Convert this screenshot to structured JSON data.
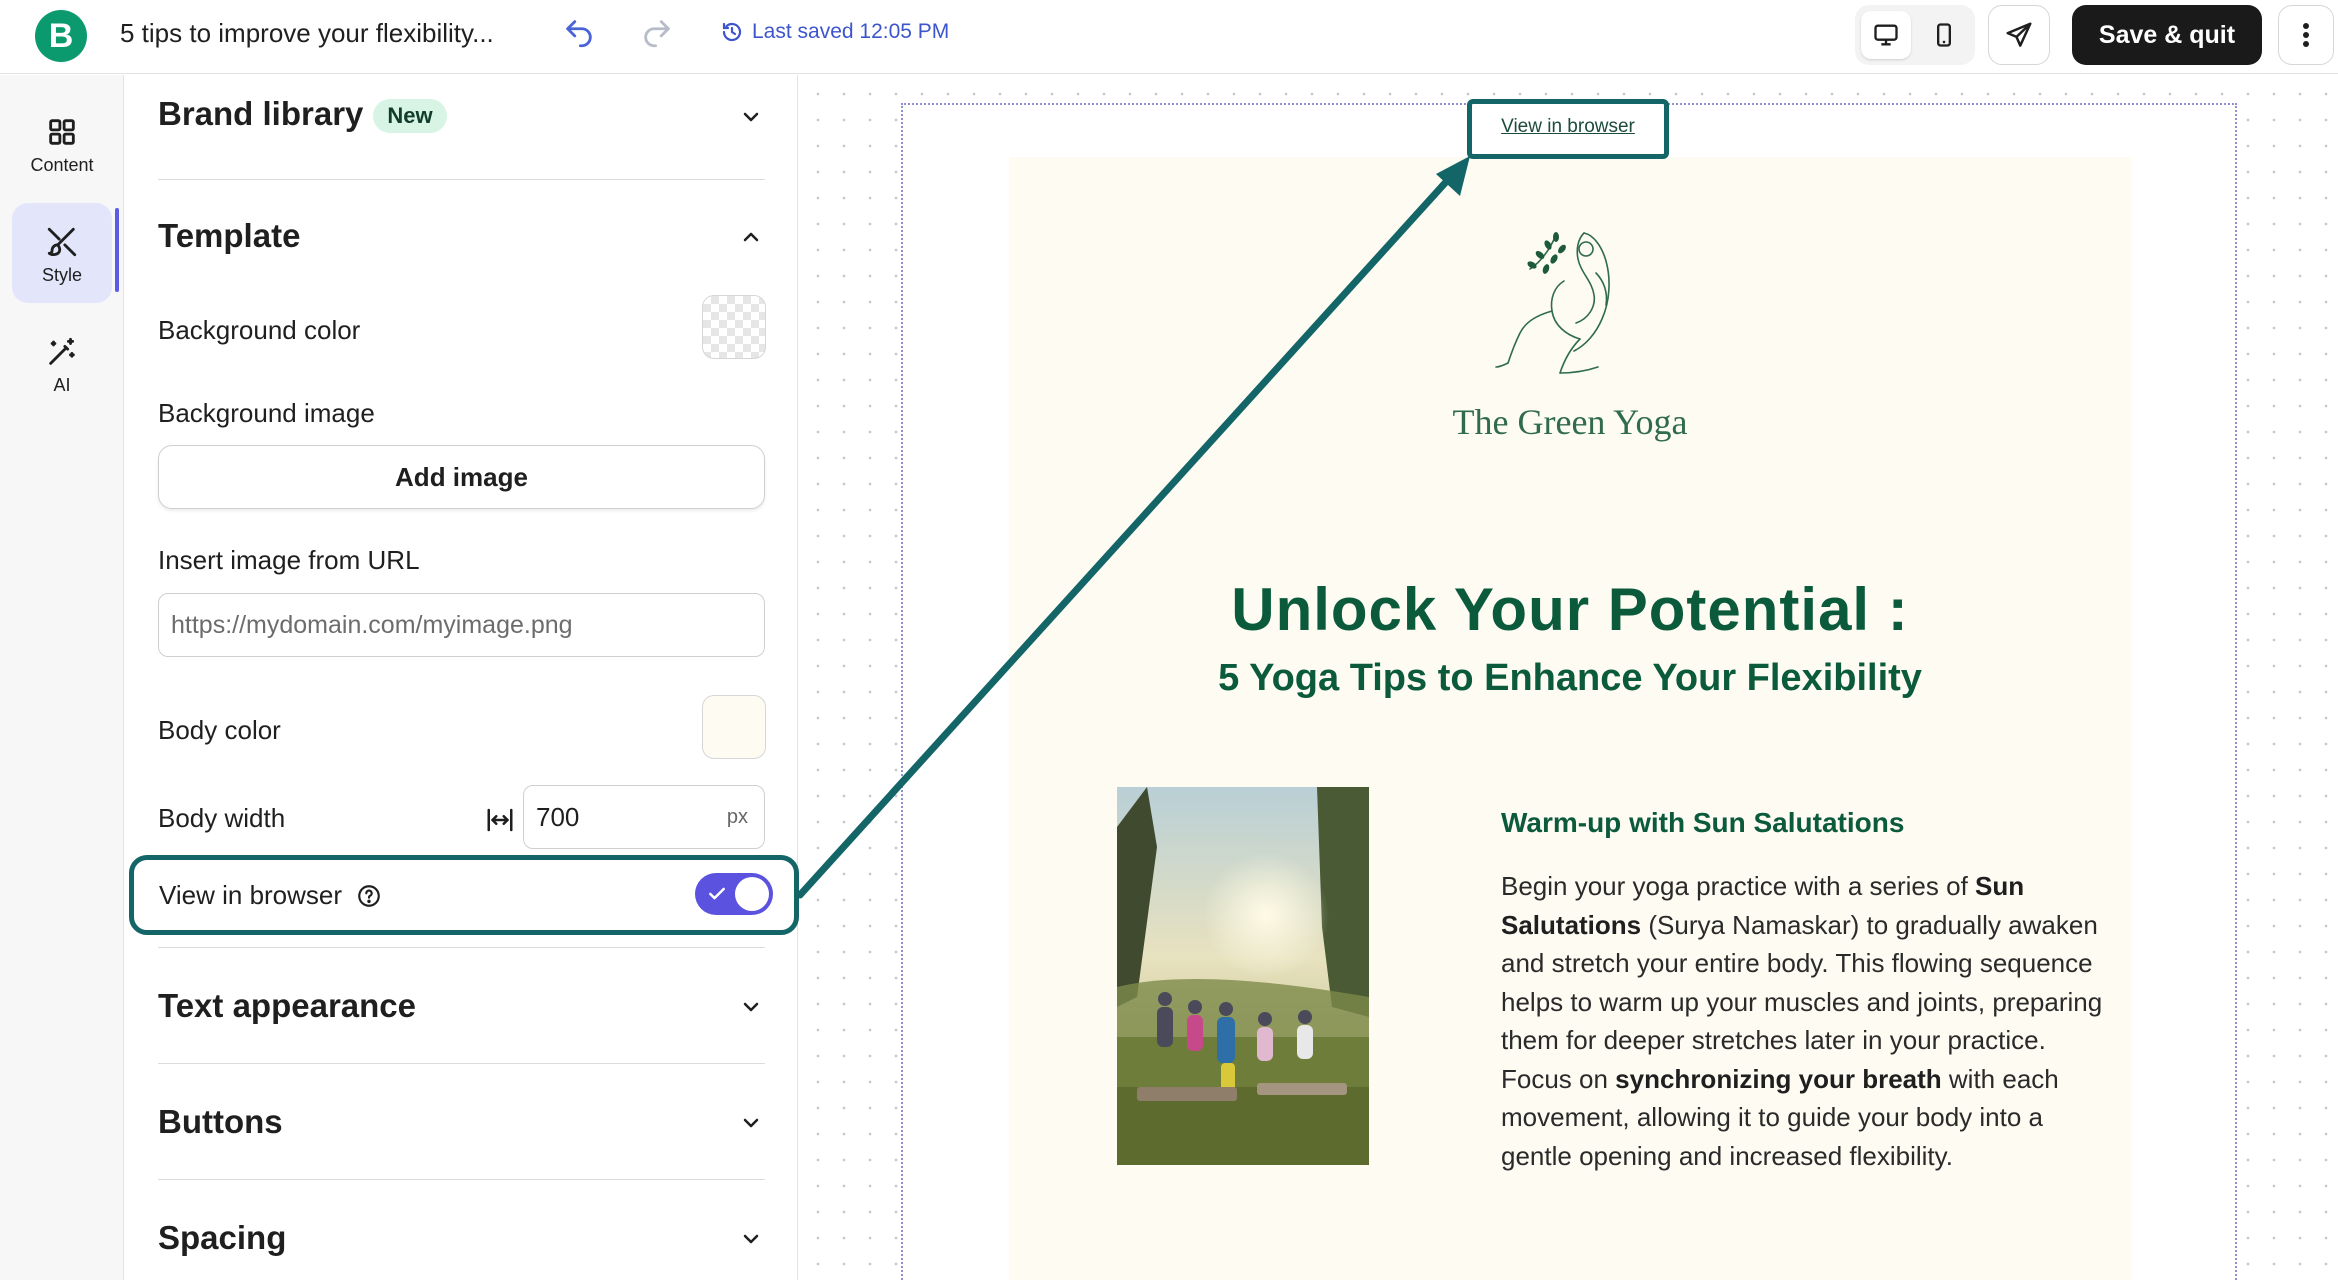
{
  "header": {
    "logo_letter": "B",
    "doc_title": "5 tips to improve your flexibility...",
    "last_saved": "Last saved 12:05 PM",
    "save_label": "Save & quit"
  },
  "rail": {
    "items": [
      {
        "label": "Content",
        "icon": "grid-icon"
      },
      {
        "label": "Style",
        "icon": "brush-icon"
      },
      {
        "label": "AI",
        "icon": "magic-wand-icon"
      }
    ],
    "active": "Style"
  },
  "panel": {
    "brand_library": {
      "title": "Brand library",
      "badge": "New"
    },
    "template": {
      "title": "Template",
      "background_color_label": "Background color",
      "background_image_label": "Background image",
      "add_image_label": "Add image",
      "insert_url_label": "Insert image from URL",
      "url_placeholder": "https://mydomain.com/myimage.png",
      "body_color_label": "Body color",
      "body_color": "#fdfbf2",
      "body_width_label": "Body width",
      "body_width_value": "700",
      "body_width_unit": "px",
      "view_in_browser_label": "View in browser",
      "view_in_browser_enabled": true
    },
    "text_appearance": {
      "title": "Text appearance"
    },
    "buttons": {
      "title": "Buttons"
    },
    "spacing": {
      "title": "Spacing"
    }
  },
  "email": {
    "view_in_browser_link": "View in browser",
    "brand_name": "The Green Yoga",
    "hero_title": "Unlock Your Potential :",
    "hero_subtitle": "5 Yoga Tips to Enhance Your Flexibility",
    "article_title": "Warm-up with Sun Salutations",
    "article_body": {
      "p1": "Begin your yoga practice with a series of ",
      "b1": "Sun Salutations",
      "p2": " (Surya Namaskar) to gradually awaken and stretch your entire body. This flowing sequence helps to warm up your muscles and joints, preparing them for deeper stretches later in your practice. Focus on ",
      "b2": "synchronizing your breath",
      "p3": " with each movement, allowing it to guide your body into a gentle opening and increased flexibility."
    }
  },
  "colors": {
    "brand_green": "#0b996e",
    "accent_purple": "#5b52e0",
    "annotation_teal": "#136567",
    "heading_green": "#0a5a3b",
    "email_body_bg": "#fdfbf2"
  }
}
